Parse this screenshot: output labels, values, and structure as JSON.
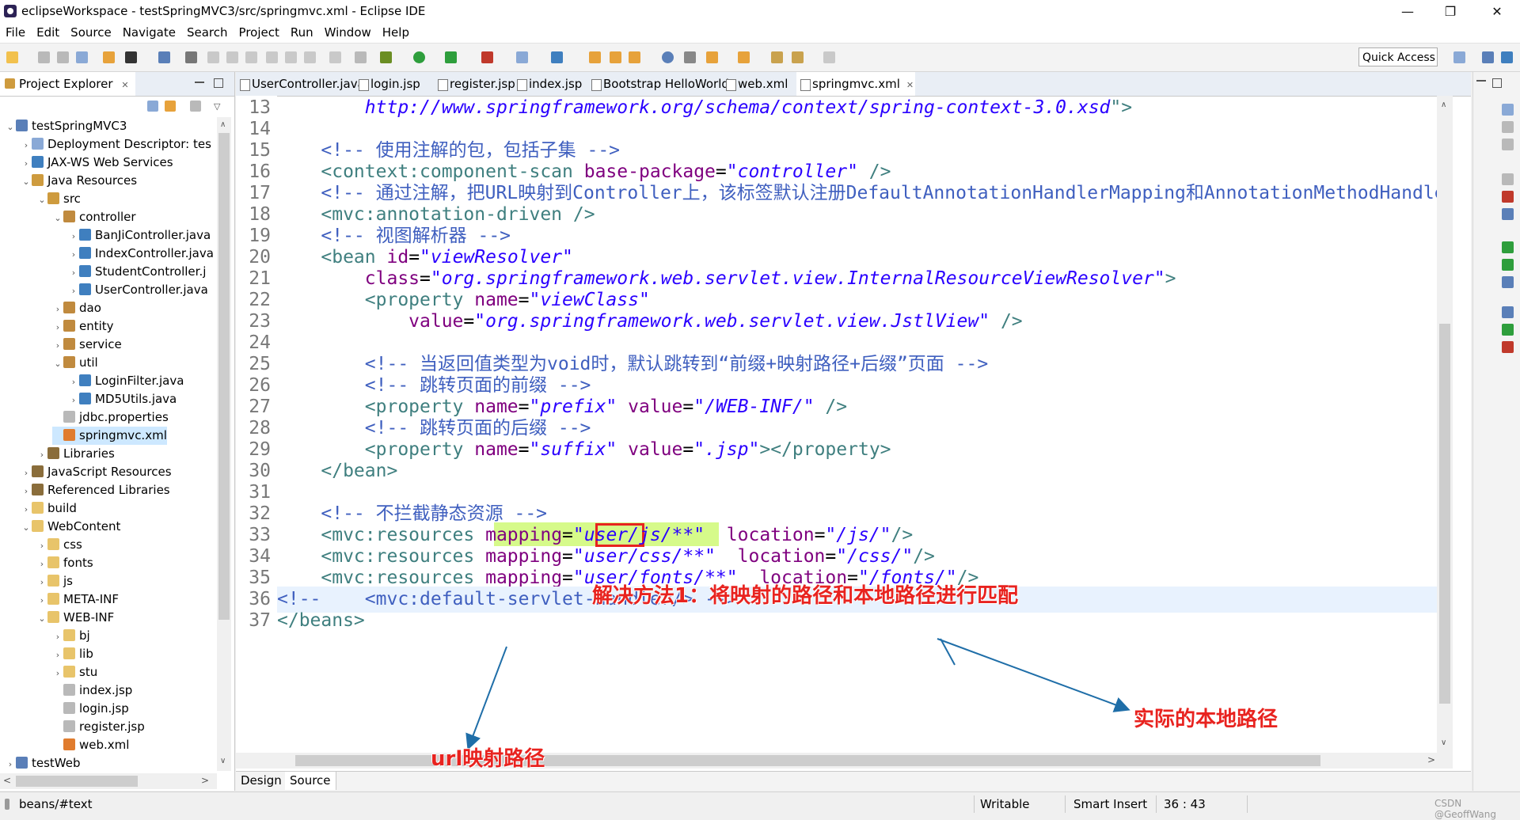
{
  "window": {
    "title": "eclipseWorkspace - testSpringMVC3/src/springmvc.xml - Eclipse IDE",
    "minimize": "—",
    "restore": "❐",
    "close": "✕"
  },
  "menu": [
    "File",
    "Edit",
    "Source",
    "Navigate",
    "Search",
    "Project",
    "Run",
    "Window",
    "Help"
  ],
  "toolbar": {
    "quick_access": "Quick Access"
  },
  "project_explorer": {
    "tab_label": "Project Explorer",
    "tab_close": "✕",
    "tree": [
      {
        "label": "testSpringMVC3",
        "depth": 0,
        "arrow": "v",
        "icon": "project"
      },
      {
        "label": "Deployment Descriptor: tes",
        "depth": 1,
        "arrow": ">",
        "icon": "descriptor"
      },
      {
        "label": "JAX-WS Web Services",
        "depth": 1,
        "arrow": ">",
        "icon": "webservice"
      },
      {
        "label": "Java Resources",
        "depth": 1,
        "arrow": "v",
        "icon": "resources"
      },
      {
        "label": "src",
        "depth": 2,
        "arrow": "v",
        "icon": "srcfolder"
      },
      {
        "label": "controller",
        "depth": 3,
        "arrow": "v",
        "icon": "package"
      },
      {
        "label": "BanJiController.java",
        "depth": 4,
        "arrow": ">",
        "icon": "java"
      },
      {
        "label": "IndexController.java",
        "depth": 4,
        "arrow": ">",
        "icon": "java"
      },
      {
        "label": "StudentController.j",
        "depth": 4,
        "arrow": ">",
        "icon": "java"
      },
      {
        "label": "UserController.java",
        "depth": 4,
        "arrow": ">",
        "icon": "java"
      },
      {
        "label": "dao",
        "depth": 3,
        "arrow": ">",
        "icon": "package"
      },
      {
        "label": "entity",
        "depth": 3,
        "arrow": ">",
        "icon": "package"
      },
      {
        "label": "service",
        "depth": 3,
        "arrow": ">",
        "icon": "package"
      },
      {
        "label": "util",
        "depth": 3,
        "arrow": "v",
        "icon": "package"
      },
      {
        "label": "LoginFilter.java",
        "depth": 4,
        "arrow": ">",
        "icon": "java"
      },
      {
        "label": "MD5Utils.java",
        "depth": 4,
        "arrow": ">",
        "icon": "java"
      },
      {
        "label": "jdbc.properties",
        "depth": 3,
        "arrow": "",
        "icon": "file"
      },
      {
        "label": "springmvc.xml",
        "depth": 3,
        "arrow": "",
        "icon": "xml",
        "selected": true
      },
      {
        "label": "Libraries",
        "depth": 2,
        "arrow": ">",
        "icon": "library"
      },
      {
        "label": "JavaScript Resources",
        "depth": 1,
        "arrow": ">",
        "icon": "library"
      },
      {
        "label": "Referenced Libraries",
        "depth": 1,
        "arrow": ">",
        "icon": "library"
      },
      {
        "label": "build",
        "depth": 1,
        "arrow": ">",
        "icon": "folder"
      },
      {
        "label": "WebContent",
        "depth": 1,
        "arrow": "v",
        "icon": "folder"
      },
      {
        "label": "css",
        "depth": 2,
        "arrow": ">",
        "icon": "folder"
      },
      {
        "label": "fonts",
        "depth": 2,
        "arrow": ">",
        "icon": "folder"
      },
      {
        "label": "js",
        "depth": 2,
        "arrow": ">",
        "icon": "folder"
      },
      {
        "label": "META-INF",
        "depth": 2,
        "arrow": ">",
        "icon": "folder"
      },
      {
        "label": "WEB-INF",
        "depth": 2,
        "arrow": "v",
        "icon": "folder"
      },
      {
        "label": "bj",
        "depth": 3,
        "arrow": ">",
        "icon": "folder"
      },
      {
        "label": "lib",
        "depth": 3,
        "arrow": ">",
        "icon": "folder"
      },
      {
        "label": "stu",
        "depth": 3,
        "arrow": ">",
        "icon": "folder"
      },
      {
        "label": "index.jsp",
        "depth": 3,
        "arrow": "",
        "icon": "file"
      },
      {
        "label": "login.jsp",
        "depth": 3,
        "arrow": "",
        "icon": "file"
      },
      {
        "label": "register.jsp",
        "depth": 3,
        "arrow": "",
        "icon": "file"
      },
      {
        "label": "web.xml",
        "depth": 3,
        "arrow": "",
        "icon": "xml"
      },
      {
        "label": "testWeb",
        "depth": 0,
        "arrow": ">",
        "icon": "project"
      }
    ]
  },
  "editor": {
    "tabs": [
      {
        "label": "UserController.java",
        "icon": "java-file-icon"
      },
      {
        "label": "login.jsp",
        "icon": "jsp-file-icon"
      },
      {
        "label": "register.jsp",
        "icon": "jsp-file-icon"
      },
      {
        "label": "index.jsp",
        "icon": "jsp-file-icon"
      },
      {
        "label": "Bootstrap HelloWorld",
        "icon": "browser-icon"
      },
      {
        "label": "web.xml",
        "icon": "xml-file-icon"
      },
      {
        "label": "springmvc.xml",
        "icon": "xml-file-icon",
        "active": true,
        "close": "✕"
      }
    ],
    "current_line": 36,
    "lines": [
      {
        "n": "13",
        "tokens": [
          [
            "val",
            "        http://www.springframework.org/schema/context/spring-context-3.0.xsd"
          ],
          [
            "tag",
            "\">"
          ]
        ]
      },
      {
        "n": "14",
        "tokens": []
      },
      {
        "n": "15",
        "tokens": [
          [
            "com",
            "    <!-- 使用注解的包，包括子集 -->"
          ]
        ]
      },
      {
        "n": "16",
        "tokens": [
          [
            "tag",
            "    <context:component-scan "
          ],
          [
            "attr",
            "base-package"
          ],
          [
            "plain",
            "="
          ],
          [
            "val",
            "\"controller\""
          ],
          [
            "tag",
            " />"
          ]
        ]
      },
      {
        "n": "17",
        "tokens": [
          [
            "com",
            "    <!-- 通过注解，把URL映射到Controller上，该标签默认注册DefaultAnnotationHandlerMapping和AnnotationMethodHandlerAdapter -->"
          ]
        ]
      },
      {
        "n": "18",
        "tokens": [
          [
            "tag",
            "    <mvc:annotation-driven />"
          ]
        ]
      },
      {
        "n": "19",
        "tokens": [
          [
            "com",
            "    <!-- 视图解析器 -->"
          ]
        ]
      },
      {
        "n": "20",
        "tokens": [
          [
            "tag",
            "    <bean "
          ],
          [
            "attr",
            "id"
          ],
          [
            "plain",
            "="
          ],
          [
            "val",
            "\"viewResolver\""
          ]
        ]
      },
      {
        "n": "21",
        "tokens": [
          [
            "attr",
            "        class"
          ],
          [
            "plain",
            "="
          ],
          [
            "val",
            "\"org.springframework.web.servlet.view.InternalResourceViewResolver\""
          ],
          [
            "tag",
            ">"
          ]
        ]
      },
      {
        "n": "22",
        "tokens": [
          [
            "tag",
            "        <property "
          ],
          [
            "attr",
            "name"
          ],
          [
            "plain",
            "="
          ],
          [
            "val",
            "\"viewClass\""
          ]
        ]
      },
      {
        "n": "23",
        "tokens": [
          [
            "attr",
            "            value"
          ],
          [
            "plain",
            "="
          ],
          [
            "val",
            "\"org.springframework.web.servlet.view.JstlView\""
          ],
          [
            "tag",
            " />"
          ]
        ]
      },
      {
        "n": "24",
        "tokens": []
      },
      {
        "n": "25",
        "tokens": [
          [
            "com",
            "        <!-- 当返回值类型为void时，默认跳转到“前缀+映射路径+后缀”页面 -->"
          ]
        ]
      },
      {
        "n": "26",
        "tokens": [
          [
            "com",
            "        <!-- 跳转页面的前缀 -->"
          ]
        ]
      },
      {
        "n": "27",
        "tokens": [
          [
            "tag",
            "        <property "
          ],
          [
            "attr",
            "name"
          ],
          [
            "plain",
            "="
          ],
          [
            "val",
            "\"prefix\""
          ],
          [
            "plain",
            " "
          ],
          [
            "attr",
            "value"
          ],
          [
            "plain",
            "="
          ],
          [
            "val",
            "\"/WEB-INF/\""
          ],
          [
            "tag",
            " />"
          ]
        ]
      },
      {
        "n": "28",
        "tokens": [
          [
            "com",
            "        <!-- 跳转页面的后缀 -->"
          ]
        ]
      },
      {
        "n": "29",
        "tokens": [
          [
            "tag",
            "        <property "
          ],
          [
            "attr",
            "name"
          ],
          [
            "plain",
            "="
          ],
          [
            "val",
            "\"suffix\""
          ],
          [
            "plain",
            " "
          ],
          [
            "attr",
            "value"
          ],
          [
            "plain",
            "="
          ],
          [
            "val",
            "\".jsp\""
          ],
          [
            "tag",
            "></property>"
          ]
        ]
      },
      {
        "n": "30",
        "tokens": [
          [
            "tag",
            "    </bean>"
          ]
        ]
      },
      {
        "n": "31",
        "tokens": []
      },
      {
        "n": "32",
        "tokens": [
          [
            "com",
            "    <!-- 不拦截静态资源 -->"
          ]
        ]
      },
      {
        "n": "33",
        "tokens": [
          [
            "tag",
            "    <mvc:resources "
          ],
          [
            "attr",
            "mapping"
          ],
          [
            "plain",
            "="
          ],
          [
            "val",
            "\"user/js/**\""
          ],
          [
            "plain",
            "  "
          ],
          [
            "attr",
            "location"
          ],
          [
            "plain",
            "="
          ],
          [
            "val",
            "\"/js/\""
          ],
          [
            "tag",
            "/>"
          ]
        ]
      },
      {
        "n": "34",
        "tokens": [
          [
            "tag",
            "    <mvc:resources "
          ],
          [
            "attr",
            "mapping"
          ],
          [
            "plain",
            "="
          ],
          [
            "val",
            "\"user/css/**\""
          ],
          [
            "plain",
            "  "
          ],
          [
            "attr",
            "location"
          ],
          [
            "plain",
            "="
          ],
          [
            "val",
            "\"/css/\""
          ],
          [
            "tag",
            "/>"
          ]
        ]
      },
      {
        "n": "35",
        "tokens": [
          [
            "tag",
            "    <mvc:resources "
          ],
          [
            "attr",
            "mapping"
          ],
          [
            "plain",
            "="
          ],
          [
            "val",
            "\"user/fonts/**\""
          ],
          [
            "plain",
            "  "
          ],
          [
            "attr",
            "location"
          ],
          [
            "plain",
            "="
          ],
          [
            "val",
            "\"/fonts/\""
          ],
          [
            "tag",
            "/>"
          ]
        ]
      },
      {
        "n": "36",
        "tokens": [
          [
            "com",
            "<!--    <mvc:default-servlet-handler/> -->"
          ]
        ]
      },
      {
        "n": "37",
        "tokens": [
          [
            "tag",
            "</beans>"
          ]
        ]
      }
    ],
    "bottom_tabs": [
      "Design",
      "Source"
    ]
  },
  "annotations": {
    "solution": "解决方法1：将映射的路径和本地路径进行匹配",
    "local_path": "实际的本地路径",
    "url_path": "url映射路径",
    "color": "#e8231f"
  },
  "status": {
    "selection": "beans/#text",
    "writable": "Writable",
    "insert_mode": "Smart Insert",
    "position": "36 : 43"
  },
  "watermark": "CSDN @GeoffWang"
}
